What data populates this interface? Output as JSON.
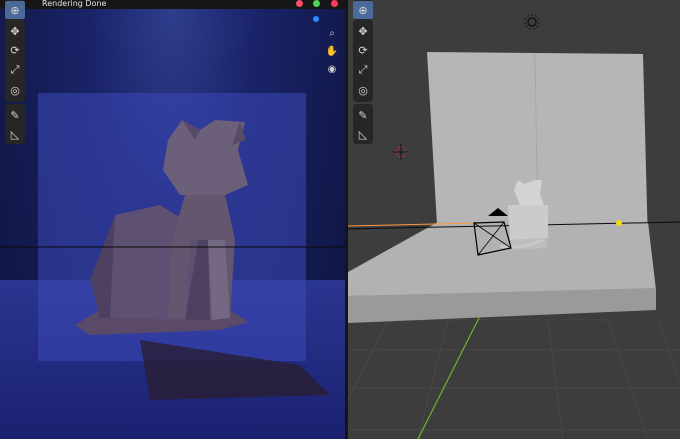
{
  "render_view": {
    "status": "Rendering Done",
    "title_dots": [
      "#ff4f6d",
      "#4fd35a",
      "#ff3b5c"
    ],
    "nav_icons": [
      "zoom-icon",
      "hand-pan-icon",
      "camera-view-icon"
    ]
  },
  "toolbar": {
    "tools": [
      "cursor-tool",
      "move-tool",
      "rotate-tool",
      "scale-tool",
      "transform-tool",
      "annotate-tool",
      "measure-tool"
    ],
    "active_tool": "cursor-tool"
  },
  "colors": {
    "render_bg": "#121a4e",
    "viewport_bg": "#3d3d3d",
    "selection": "#ff9a3c",
    "light_point": "#f2e000",
    "x_axis": "#b02a4a",
    "y_axis": "#6db330"
  }
}
